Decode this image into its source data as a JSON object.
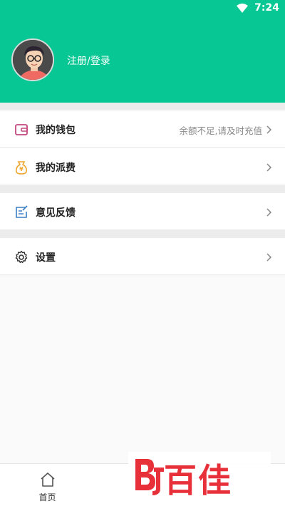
{
  "status_bar": {
    "time": "7:24"
  },
  "header": {
    "login_label": "注册/登录"
  },
  "menu": {
    "wallet": {
      "label": "我的钱包",
      "hint": "余额不足,请及时充值"
    },
    "fee": {
      "label": "我的派费"
    },
    "feedback": {
      "label": "意见反馈"
    },
    "settings": {
      "label": "设置"
    }
  },
  "tabbar": {
    "tabs": [
      {
        "label": "首页"
      },
      {
        "label": ""
      },
      {
        "label": ""
      }
    ]
  },
  "watermark": {
    "text": "百佳"
  },
  "colors": {
    "accent": "#07c894",
    "wallet_icon": "#c2487f",
    "fee_icon": "#f0a52b",
    "feedback_icon": "#3b7fc4",
    "watermark": "#e8303a"
  }
}
